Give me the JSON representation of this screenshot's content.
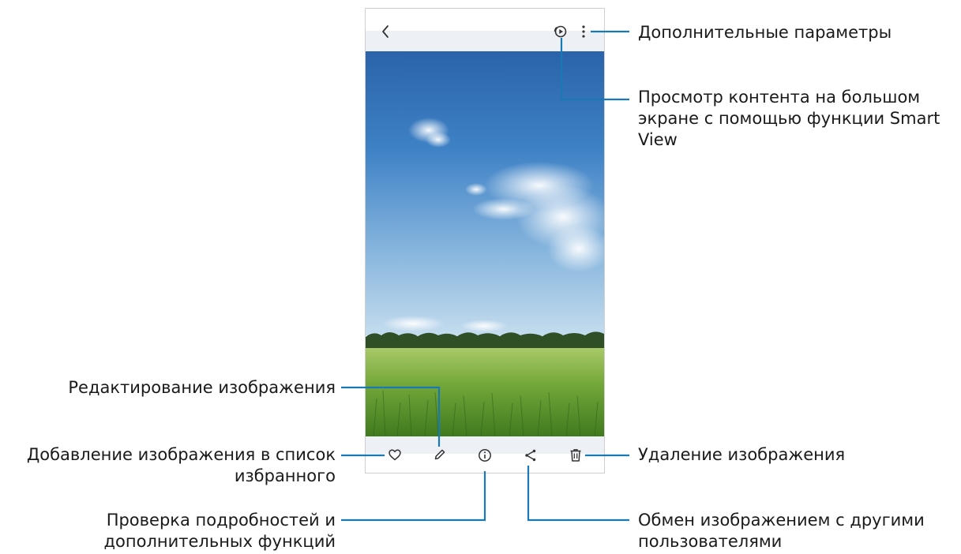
{
  "callouts": {
    "more_options": "Дополнительные параметры",
    "smart_view": [
      "Просмотр контента на большом",
      "экране с помощью функции Smart",
      "View"
    ],
    "edit": "Редактирование изображения",
    "favorite": [
      "Добавление изображения в список",
      "избранного"
    ],
    "delete": "Удаление изображения",
    "details": [
      "Проверка подробностей и",
      "дополнительных функций"
    ],
    "share": [
      "Обмен изображением с другими",
      "пользователями"
    ]
  },
  "icons": {
    "back": "chevron-left-icon",
    "smart_view": "smart-view-icon",
    "more": "more-options-icon",
    "favorite": "heart-icon",
    "edit": "pencil-icon",
    "details": "info-icon",
    "share": "share-icon",
    "delete": "trash-icon"
  },
  "colors": {
    "leader_line": "#1a78b4",
    "icon": "#333333"
  }
}
